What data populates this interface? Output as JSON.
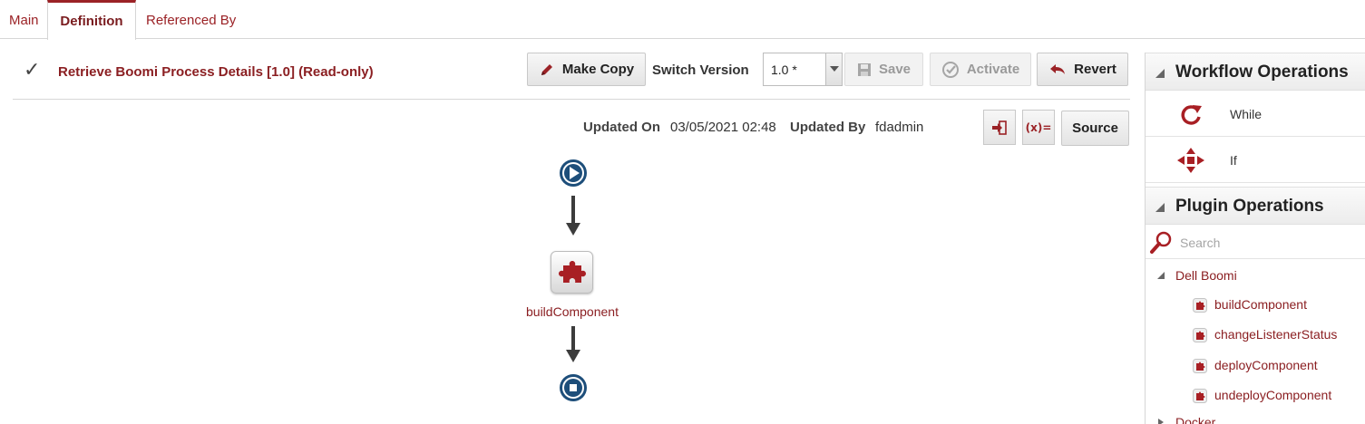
{
  "tabs": {
    "main": "Main",
    "definition": "Definition",
    "referenced_by": "Referenced By"
  },
  "header": {
    "title": "Retrieve Boomi Process Details [1.0] (Read-only)",
    "make_copy": "Make Copy",
    "switch_version_label": "Switch Version",
    "version_value": "1.0 *",
    "save": "Save",
    "activate": "Activate",
    "revert": "Revert"
  },
  "meta": {
    "updated_on_label": "Updated On",
    "updated_on_value": "03/05/2021 02:48",
    "updated_by_label": "Updated By",
    "updated_by_value": "fdadmin",
    "source_button": "Source",
    "variables_button": "(x)="
  },
  "diagram": {
    "component_label": "buildComponent"
  },
  "workflow_operations": {
    "title": "Workflow Operations",
    "items": [
      {
        "label": "While",
        "icon": "loop-icon"
      },
      {
        "label": "If",
        "icon": "branch-arrows-icon"
      }
    ]
  },
  "plugin_operations": {
    "title": "Plugin Operations",
    "search_placeholder": "Search",
    "groups": [
      {
        "label": "Dell Boomi",
        "items": [
          "buildComponent",
          "changeListenerStatus",
          "deployComponent",
          "undeployComponent"
        ]
      },
      {
        "label": "Docker",
        "items": []
      }
    ]
  },
  "colors": {
    "accent": "#9b2226",
    "node_blue": "#1d4e7a"
  }
}
